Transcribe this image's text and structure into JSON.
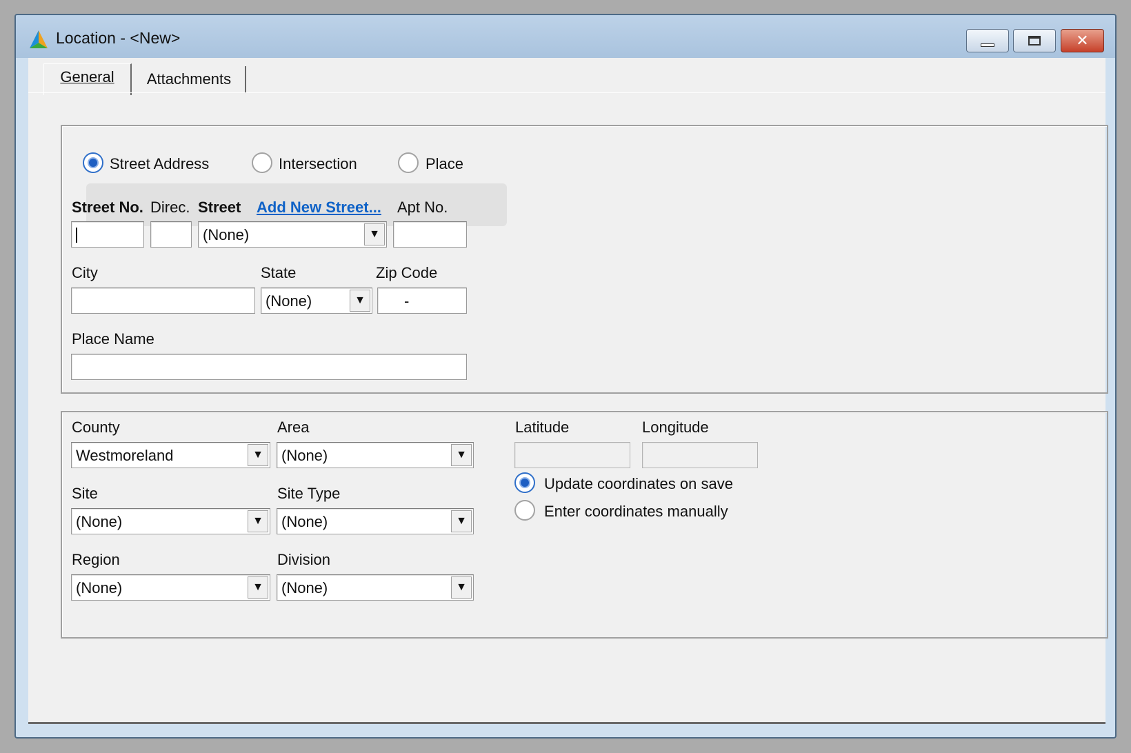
{
  "window": {
    "title": "Location - <New>",
    "min_label": "",
    "max_label": "",
    "close_label": "✕"
  },
  "tabs": [
    {
      "label": "General",
      "active": true
    },
    {
      "label": "Attachments",
      "active": false
    }
  ],
  "location_type": {
    "options": [
      "Street Address",
      "Intersection",
      "Place"
    ],
    "selected": "Street Address"
  },
  "address": {
    "street_no_label": "Street No.",
    "direc_label": "Direc.",
    "street_label": "Street",
    "add_street_link": "Add New Street...",
    "apt_label": "Apt No.",
    "street_no_value": "",
    "direc_value": "",
    "street_value": "(None)",
    "apt_value": "",
    "city_label": "City",
    "state_label": "State",
    "zip_label": "Zip Code",
    "city_value": "",
    "state_value": "(None)",
    "zip_value": "-",
    "place_name_label": "Place Name",
    "place_name_value": ""
  },
  "region_info": {
    "county_label": "County",
    "county_value": "Westmoreland",
    "area_label": "Area",
    "area_value": "(None)",
    "site_label": "Site",
    "site_value": "(None)",
    "site_type_label": "Site Type",
    "site_type_value": "(None)",
    "region_label": "Region",
    "region_value": "(None)",
    "division_label": "Division",
    "division_value": "(None)"
  },
  "coordinates": {
    "latitude_label": "Latitude",
    "longitude_label": "Longitude",
    "latitude_value": "",
    "longitude_value": "",
    "options": [
      "Update coordinates on save",
      "Enter coordinates manually"
    ],
    "selected": "Update coordinates on save"
  },
  "icons": {
    "app": "tri-color-triangle-icon",
    "dropdown": "chevron-down-icon"
  }
}
